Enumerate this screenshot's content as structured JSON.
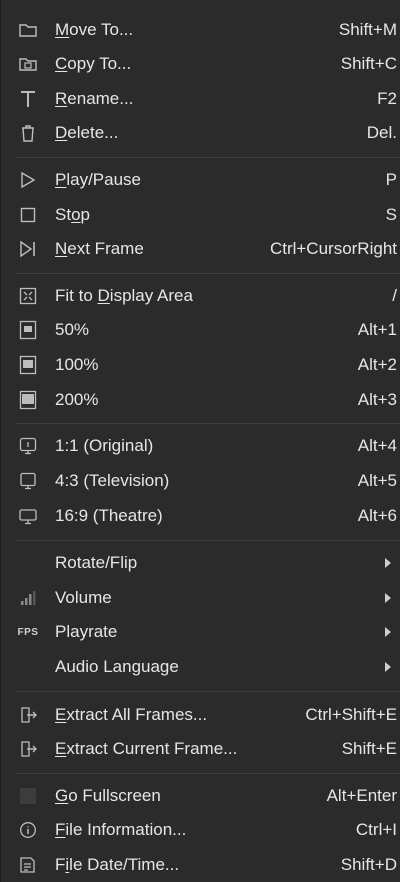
{
  "menu": {
    "items": [
      {
        "label": "Move To...",
        "u": "M",
        "shortcut": "Shift+M",
        "icon": "folder-move-icon"
      },
      {
        "label": "Copy To...",
        "u": "C",
        "shortcut": "Shift+C",
        "icon": "folder-copy-icon"
      },
      {
        "label": "Rename...",
        "u": "R",
        "shortcut": "F2",
        "icon": "rename-icon"
      },
      {
        "label": "Delete...",
        "u": "D",
        "shortcut": "Del.",
        "icon": "trash-icon"
      },
      {
        "label": "Play/Pause",
        "u": "P",
        "shortcut": "P",
        "icon": "play-icon"
      },
      {
        "label": "Stop",
        "u": "o",
        "shortcut": "S",
        "icon": "stop-icon"
      },
      {
        "label": "Next Frame",
        "u": "N",
        "shortcut": "Ctrl+CursorRight",
        "icon": "next-frame-icon"
      },
      {
        "label": "Fit to Display Area",
        "u": "D",
        "shortcut": "/",
        "icon": "fit-display-icon"
      },
      {
        "label": "50%",
        "u": "",
        "shortcut": "Alt+1",
        "icon": "zoom-50-icon"
      },
      {
        "label": "100%",
        "u": "",
        "shortcut": "Alt+2",
        "icon": "zoom-100-icon"
      },
      {
        "label": "200%",
        "u": "",
        "shortcut": "Alt+3",
        "icon": "zoom-200-icon"
      },
      {
        "label": "1:1 (Original)",
        "u": "",
        "shortcut": "Alt+4",
        "icon": "aspect-original-icon"
      },
      {
        "label": "4:3 (Television)",
        "u": "",
        "shortcut": "Alt+5",
        "icon": "aspect-tv-icon"
      },
      {
        "label": "16:9 (Theatre)",
        "u": "",
        "shortcut": "Alt+6",
        "icon": "aspect-theatre-icon"
      },
      {
        "label": "Rotate/Flip",
        "u": "",
        "submenu": true,
        "icon": ""
      },
      {
        "label": "Volume",
        "u": "",
        "submenu": true,
        "icon": "volume-icon"
      },
      {
        "label": "Playrate",
        "u": "",
        "submenu": true,
        "icon": "fps-icon",
        "icon_text": "FPS"
      },
      {
        "label": "Audio Language",
        "u": "",
        "submenu": true,
        "icon": ""
      },
      {
        "label": "Extract All Frames...",
        "u": "E",
        "shortcut": "Ctrl+Shift+E",
        "icon": "extract-all-icon"
      },
      {
        "label": "Extract Current Frame...",
        "u": "E",
        "shortcut": "Shift+E",
        "icon": "extract-current-icon"
      },
      {
        "label": "Go Fullscreen",
        "u": "G",
        "shortcut": "Alt+Enter",
        "icon": "fullscreen-icon"
      },
      {
        "label": "File Information...",
        "u": "F",
        "shortcut": "Ctrl+I",
        "icon": "info-icon"
      },
      {
        "label": "File Date/Time...",
        "u": "i",
        "shortcut": "Shift+D",
        "icon": "file-date-icon"
      }
    ]
  }
}
